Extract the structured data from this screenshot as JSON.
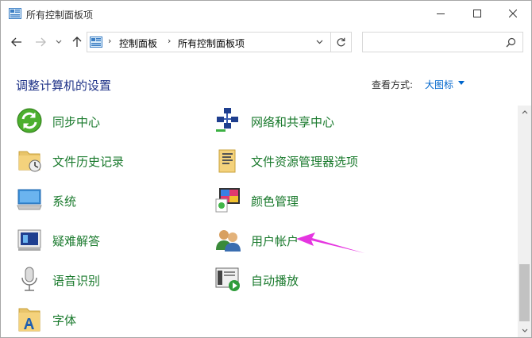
{
  "window": {
    "title": "所有控制面板项",
    "controls": {
      "minimize": "minimize",
      "maximize": "maximize",
      "close": "close"
    }
  },
  "nav": {
    "back_icon": "arrow-left-icon",
    "forward_icon": "arrow-right-icon",
    "breadcrumb": [
      "控制面板",
      "所有控制面板项"
    ]
  },
  "search": {
    "placeholder": "",
    "value": ""
  },
  "content": {
    "title": "调整计算机的设置",
    "view_by_label": "查看方式:",
    "view_by_value": "大图标"
  },
  "items": [
    {
      "label": "同步中心",
      "icon": "sync-center-icon"
    },
    {
      "label": "网络和共享中心",
      "icon": "network-sharing-icon"
    },
    {
      "label": "文件历史记录",
      "icon": "file-history-icon"
    },
    {
      "label": "文件资源管理器选项",
      "icon": "explorer-options-icon"
    },
    {
      "label": "系统",
      "icon": "system-icon"
    },
    {
      "label": "颜色管理",
      "icon": "color-management-icon"
    },
    {
      "label": "疑难解答",
      "icon": "troubleshooting-icon"
    },
    {
      "label": "用户帐户",
      "icon": "user-accounts-icon"
    },
    {
      "label": "语音识别",
      "icon": "speech-recognition-icon"
    },
    {
      "label": "自动播放",
      "icon": "autoplay-icon"
    },
    {
      "label": "字体",
      "icon": "fonts-icon"
    }
  ],
  "colors": {
    "item_label": "#1a7a2d",
    "page_title": "#1e3287",
    "link": "#0066cc",
    "annotation_arrow": "#e535e0"
  }
}
